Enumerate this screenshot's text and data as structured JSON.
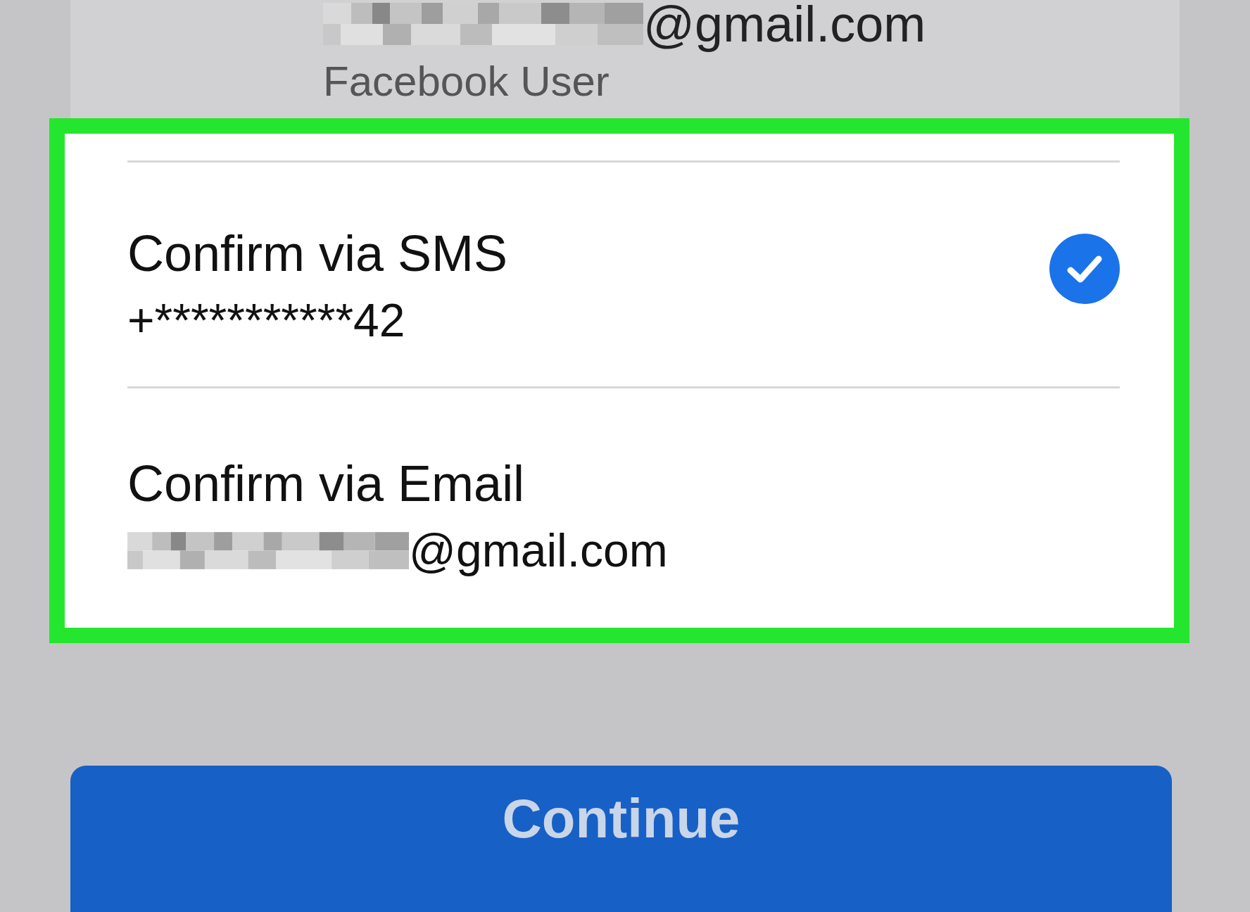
{
  "account": {
    "email": "@gmail.com",
    "email_redacted": true,
    "name": "Facebook User"
  },
  "options": [
    {
      "title": "Confirm via SMS",
      "detail": "+***********42",
      "detail_redacted": false,
      "selected": true
    },
    {
      "title": "Confirm via Email",
      "detail": "@gmail.com",
      "detail_redacted": true,
      "selected": false
    }
  ],
  "button": {
    "label": "Continue"
  }
}
